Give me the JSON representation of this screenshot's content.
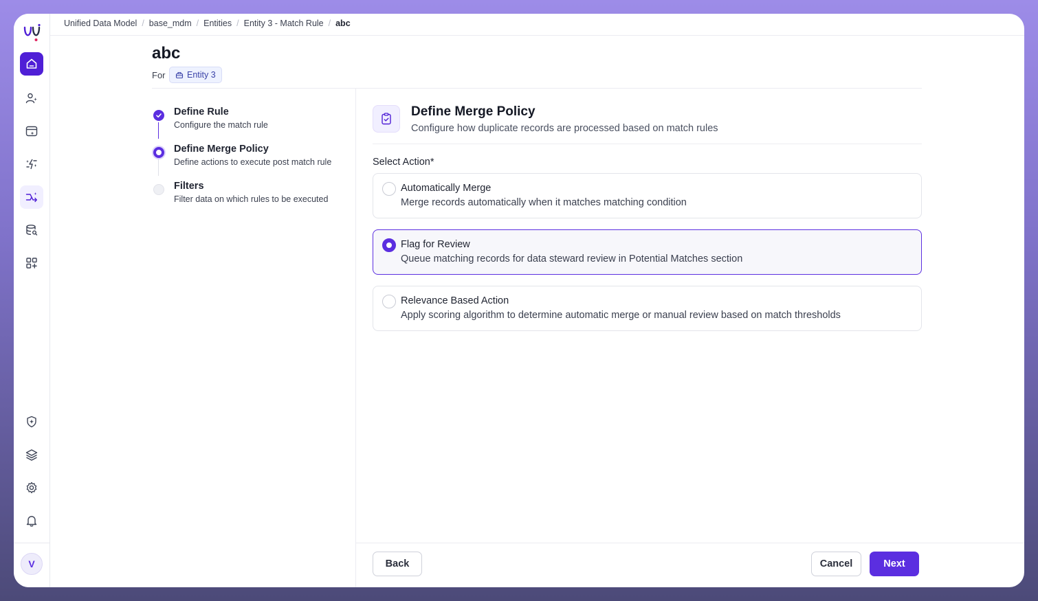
{
  "breadcrumb": [
    "Unified Data Model",
    "base_mdm",
    "Entities",
    "Entity 3 - Match Rule",
    "abc"
  ],
  "page": {
    "title": "abc",
    "for_label": "For",
    "entity": "Entity 3"
  },
  "steps": [
    {
      "title": "Define Rule",
      "desc": "Configure the match rule",
      "state": "done"
    },
    {
      "title": "Define Merge Policy",
      "desc": "Define actions to execute post match rule",
      "state": "active"
    },
    {
      "title": "Filters",
      "desc": "Filter data on which rules to be executed",
      "state": "todo"
    }
  ],
  "panel": {
    "title": "Define Merge Policy",
    "subtitle": "Configure how duplicate records are processed based on match rules",
    "select_label": "Select Action*",
    "options": [
      {
        "title": "Automatically Merge",
        "desc": "Merge records automatically when it matches matching condition",
        "selected": false
      },
      {
        "title": "Flag for Review",
        "desc": "Queue matching records for data steward review in Potential Matches section",
        "selected": true
      },
      {
        "title": "Relevance Based Action",
        "desc": "Apply scoring algorithm to determine automatic merge or manual review based on match thresholds",
        "selected": false
      }
    ]
  },
  "footer": {
    "back": "Back",
    "cancel": "Cancel",
    "next": "Next"
  },
  "user": {
    "initial": "V"
  },
  "sidebar_icons": [
    "home-icon",
    "user-sparkle-icon",
    "calendar-sparkle-icon",
    "sparkle-flash-icon",
    "merge-sparkle-icon",
    "database-search-icon",
    "grid-add-icon",
    "shield-sparkle-icon",
    "layers-icon",
    "gear-icon",
    "bell-icon"
  ],
  "colors": {
    "accent": "#5b2ee0",
    "home": "#4f1fd6"
  }
}
